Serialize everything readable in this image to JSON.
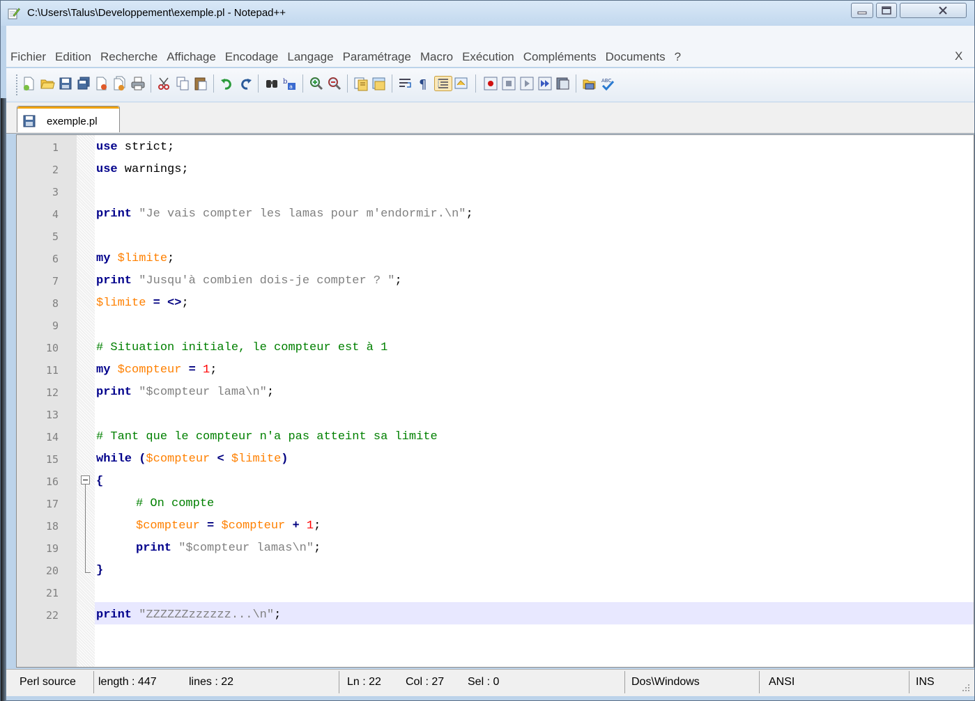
{
  "window": {
    "title": "C:\\Users\\Talus\\Developpement\\exemple.pl - Notepad++"
  },
  "menu": {
    "items": [
      "Fichier",
      "Edition",
      "Recherche",
      "Affichage",
      "Encodage",
      "Langage",
      "Paramétrage",
      "Macro",
      "Exécution",
      "Compléments",
      "Documents",
      "?"
    ],
    "close_doc": "X"
  },
  "toolbar": {
    "buttons": [
      "new-file-icon",
      "open-file-icon",
      "save-icon",
      "save-all-icon",
      "close-icon",
      "close-all-icon",
      "print-icon",
      "cut-icon",
      "copy-icon",
      "paste-icon",
      "undo-icon",
      "redo-icon",
      "find-icon",
      "replace-icon",
      "zoom-in-icon",
      "zoom-out-icon",
      "sync-vertical-icon",
      "sync-horizontal-icon",
      "word-wrap-icon",
      "show-all-chars-icon",
      "indent-guide-icon",
      "user-lang-icon",
      "record-macro-icon",
      "stop-record-icon",
      "play-macro-icon",
      "run-macro-multiple-icon",
      "save-macro-icon",
      "function-list-icon",
      "spell-check-icon"
    ]
  },
  "tab": {
    "label": "exemple.pl"
  },
  "editor": {
    "language": "Perl",
    "current_line": 22,
    "lines": [
      {
        "n": "1",
        "code": "use strict;"
      },
      {
        "n": "2",
        "code": "use warnings;"
      },
      {
        "n": "3",
        "code": ""
      },
      {
        "n": "4",
        "code": "print \"Je vais compter les lamas pour m'endormir.\\n\";"
      },
      {
        "n": "5",
        "code": ""
      },
      {
        "n": "6",
        "code": "my $limite;"
      },
      {
        "n": "7",
        "code": "print \"Jusqu'à combien dois-je compter ? \";"
      },
      {
        "n": "8",
        "code": "$limite = <>;"
      },
      {
        "n": "9",
        "code": ""
      },
      {
        "n": "10",
        "code": "# Situation initiale, le compteur est à 1"
      },
      {
        "n": "11",
        "code": "my $compteur = 1;"
      },
      {
        "n": "12",
        "code": "print \"$compteur lama\\n\";"
      },
      {
        "n": "13",
        "code": ""
      },
      {
        "n": "14",
        "code": "# Tant que le compteur n'a pas atteint sa limite"
      },
      {
        "n": "15",
        "code": "while ($compteur < $limite)"
      },
      {
        "n": "16",
        "code": "{"
      },
      {
        "n": "17",
        "code": "    # On compte"
      },
      {
        "n": "18",
        "code": "    $compteur = $compteur + 1;"
      },
      {
        "n": "19",
        "code": "    print \"$compteur lamas\\n\";"
      },
      {
        "n": "20",
        "code": "}"
      },
      {
        "n": "21",
        "code": ""
      },
      {
        "n": "22",
        "code": "print \"ZZZZZZzzzzzz...\\n\";"
      }
    ]
  },
  "status": {
    "language": "Perl source",
    "length": "length : 447",
    "lines": "lines : 22",
    "ln": "Ln : 22",
    "col": "Col : 27",
    "sel": "Sel : 0",
    "eol": "Dos\\Windows",
    "encoding": "ANSI",
    "mode": "INS"
  },
  "colors": {
    "keyword": "#00008b",
    "string": "#808080",
    "variable": "#ff8000",
    "number": "#ff0000",
    "comment": "#008000",
    "current_line": "#e8e8ff",
    "tab_accent": "#f0a30a"
  }
}
